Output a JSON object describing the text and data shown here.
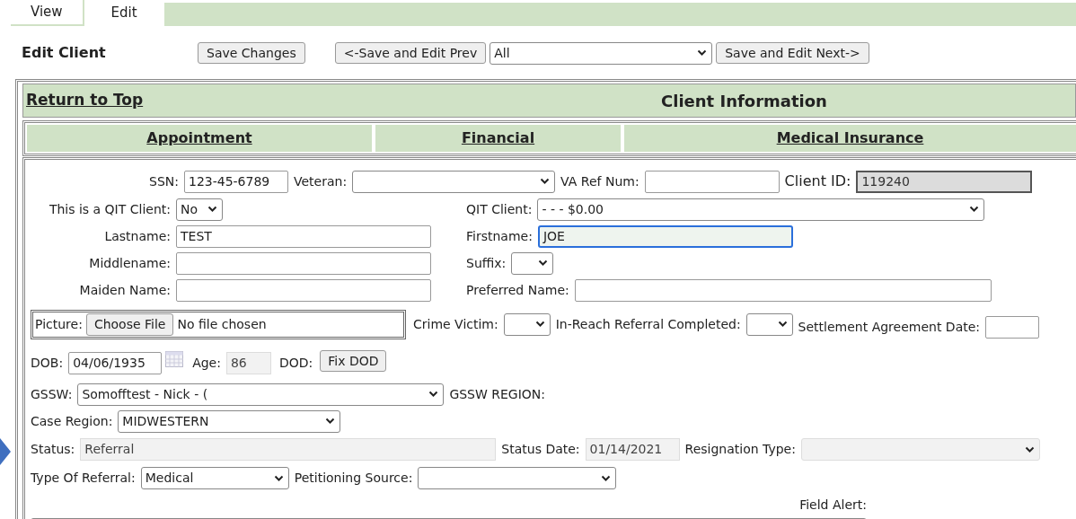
{
  "tabs": [
    {
      "label": "View",
      "selected": false
    },
    {
      "label": "Edit",
      "selected": true
    }
  ],
  "title": "Edit Client",
  "toolbar": {
    "save_button": "Save Changes",
    "prev_button": "<-Save and Edit Prev",
    "filter_select": "All",
    "next_button": "Save and Edit Next->"
  },
  "section": {
    "return_link": "Return to Top",
    "heading": "Client Information"
  },
  "section_links": [
    "Appointment",
    "Financial",
    "Medical Insurance"
  ],
  "form": {
    "ssn": {
      "label": "SSN:",
      "value": "123-45-6789"
    },
    "veteran": {
      "label": "Veteran:"
    },
    "va_ref_num": {
      "label": "VA Ref Num:"
    },
    "client_id": {
      "label": "Client ID:",
      "value": "119240",
      "readonly": true
    },
    "qit_flag": {
      "label": "This is a QIT Client:",
      "value": "No"
    },
    "qit_client": {
      "label": "QIT Client:",
      "value": "- - - $0.00"
    },
    "lastname": {
      "label": "Lastname:",
      "value": "TEST"
    },
    "firstname": {
      "label": "Firstname:",
      "value": "JOE",
      "focused": true
    },
    "middlename": {
      "label": "Middlename:"
    },
    "suffix": {
      "label": "Suffix:"
    },
    "maiden_name": {
      "label": "Maiden Name:"
    },
    "preferred_name": {
      "label": "Preferred Name:"
    },
    "picture": {
      "label": "Picture:",
      "button": "Choose File",
      "status": "No file chosen"
    },
    "crime_victim": {
      "label": "Crime Victim:"
    },
    "in_reach": {
      "label": "In-Reach Referral Completed:"
    },
    "settlement_date": {
      "label": "Settlement Agreement Date:"
    },
    "dob": {
      "label": "DOB:",
      "value": "04/06/1935"
    },
    "age": {
      "label": "Age:",
      "value": "86",
      "disabled": true
    },
    "dod": {
      "label": "DOD:",
      "button": "Fix DOD"
    },
    "gssw": {
      "label": "GSSW:",
      "value": "Somofftest - Nick - ("
    },
    "gssw_region": {
      "label": "GSSW REGION:"
    },
    "case_region": {
      "label": "Case Region:",
      "value": "MIDWESTERN"
    },
    "status": {
      "label": "Status:",
      "value": "Referral",
      "disabled": true
    },
    "status_date": {
      "label": "Status Date:",
      "value": "01/14/2021",
      "disabled": true
    },
    "resignation_type": {
      "label": "Resignation Type:",
      "disabled": true
    },
    "type_of_referral": {
      "label": "Type Of Referral:",
      "value": "Medical"
    },
    "petitioning_source": {
      "label": "Petitioning Source:"
    },
    "field_alert": {
      "label": "Field Alert:"
    }
  }
}
